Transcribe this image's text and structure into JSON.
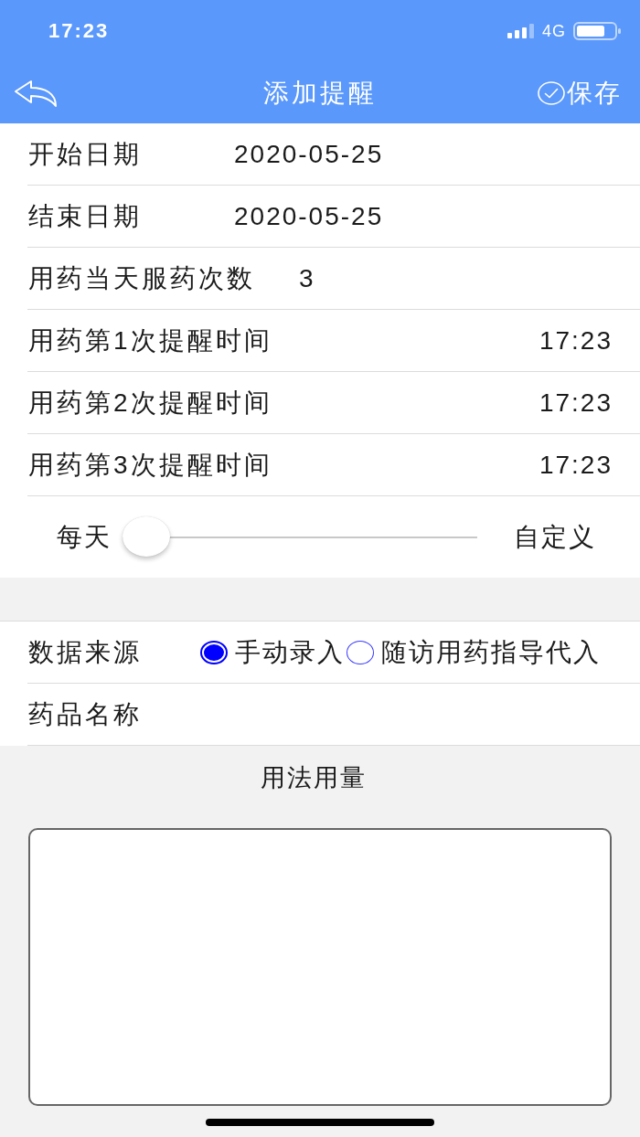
{
  "status_bar": {
    "time": "17:23",
    "network": "4G"
  },
  "nav_bar": {
    "title": "添加提醒",
    "save_label": "保存"
  },
  "rows": [
    {
      "kind": "date",
      "label": "开始日期",
      "value": "2020-05-25"
    },
    {
      "kind": "date",
      "label": "结束日期",
      "value": "2020-05-25"
    },
    {
      "kind": "count",
      "label": "用药当天服药次数",
      "value": "3"
    },
    {
      "kind": "time",
      "label": "用药第1次提醒时间",
      "value": "17:23"
    },
    {
      "kind": "time",
      "label": "用药第2次提醒时间",
      "value": "17:23"
    },
    {
      "kind": "time",
      "label": "用药第3次提醒时间",
      "value": "17:23"
    }
  ],
  "frequency_slider": {
    "left_label": "每天",
    "right_label": "自定义",
    "level": 0
  },
  "data_source": {
    "label": "数据来源",
    "options": [
      {
        "label": "手动录入",
        "selected": true
      },
      {
        "label": "随访用药指导代入",
        "selected": false
      }
    ]
  },
  "drug_name": {
    "label": "药品名称"
  },
  "usage": {
    "title": "用法用量"
  }
}
